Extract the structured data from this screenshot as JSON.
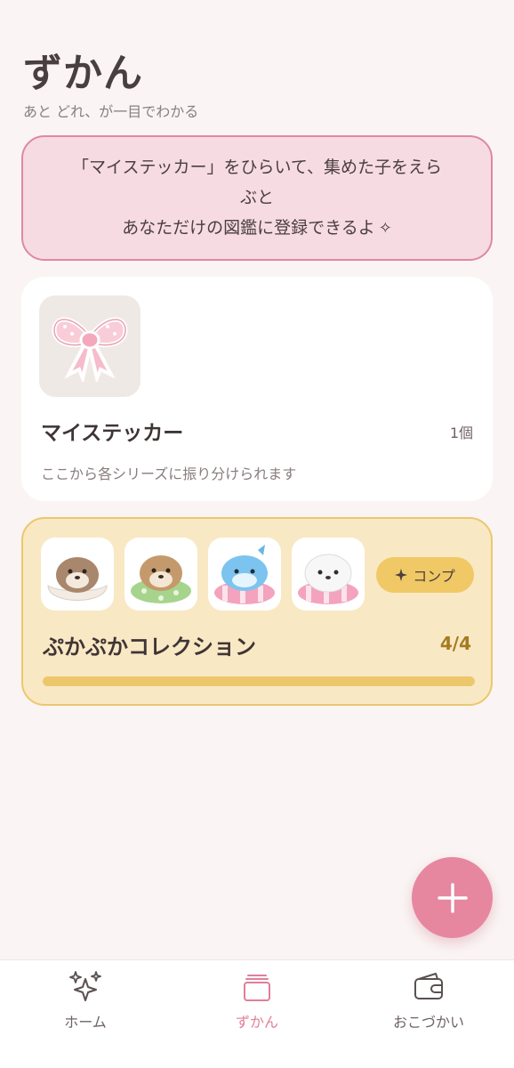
{
  "header": {
    "title": "ずかん",
    "subtitle": "あと どれ、が一目でわかる"
  },
  "info_banner": {
    "line1": "「マイステッカー」をひらいて、集めた子をえら",
    "line2": "ぶと",
    "line3": "あなただけの図鑑に登録できるよ",
    "sparkle": "✧"
  },
  "sticker_card": {
    "name": "マイステッカー",
    "count": "1個",
    "description": "ここから各シリーズに振り分けられます",
    "thumb_icon": "ribbon-bow-sticker"
  },
  "collection_card": {
    "name": "ぷかぷかコレクション",
    "progress_text": "4/4",
    "progress_fraction": 1.0,
    "badge_label": "コンプ",
    "badge_icon": "sparkle-icon",
    "figures": [
      "otter-shell-figure",
      "otter-float-figure",
      "dolphin-float-figure",
      "seal-float-figure"
    ]
  },
  "fab": {
    "icon": "plus-icon"
  },
  "tabbar": {
    "items": [
      {
        "label": "ホーム",
        "icon": "sparkles-icon",
        "active": false
      },
      {
        "label": "ずかん",
        "icon": "collection-stack-icon",
        "active": true
      },
      {
        "label": "おこづかい",
        "icon": "wallet-icon",
        "active": false
      }
    ]
  },
  "colors": {
    "accent_pink": "#e6879f",
    "banner_bg": "#f7dbe2",
    "collection_bg": "#f9e8c4",
    "collection_border": "#ecc76c",
    "progress_text": "#a57b1f"
  }
}
